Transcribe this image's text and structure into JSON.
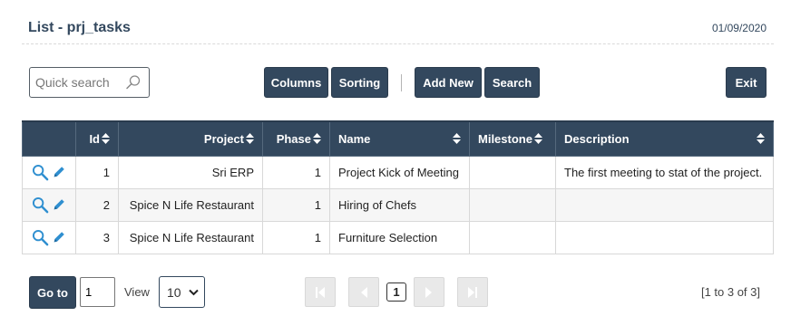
{
  "header": {
    "title": "List - prj_tasks",
    "date": "01/09/2020"
  },
  "toolbar": {
    "search_placeholder": "Quick search",
    "columns_label": "Columns",
    "sorting_label": "Sorting",
    "add_new_label": "Add New",
    "search_label": "Search",
    "exit_label": "Exit"
  },
  "table": {
    "columns": [
      "Id",
      "Project",
      "Phase",
      "Name",
      "Milestone",
      "Description"
    ],
    "rows": [
      {
        "id": "1",
        "project": "Sri ERP",
        "phase": "1",
        "name": "Project Kick of Meeting",
        "milestone": "",
        "description": "The first meeting to stat of the project."
      },
      {
        "id": "2",
        "project": "Spice N Life Restaurant",
        "phase": "1",
        "name": "Hiring of Chefs",
        "milestone": "",
        "description": ""
      },
      {
        "id": "3",
        "project": "Spice N Life Restaurant",
        "phase": "1",
        "name": "Furniture Selection",
        "milestone": "",
        "description": ""
      }
    ]
  },
  "footer": {
    "goto_label": "Go to",
    "goto_value": "1",
    "view_label": "View",
    "view_value": "10",
    "current_page": "1",
    "range_info": "[1 to 3 of 3]"
  },
  "colors": {
    "primary": "#33485e",
    "border": "#d8d8d8",
    "alt_row": "#f6f6f6",
    "disabled": "#e9e9e9"
  },
  "icons": [
    "search-icon",
    "magnifier-icon",
    "pencil-icon",
    "sort-icon",
    "first-page-icon",
    "prev-page-icon",
    "next-page-icon",
    "last-page-icon",
    "dropdown-arrow-icon"
  ]
}
